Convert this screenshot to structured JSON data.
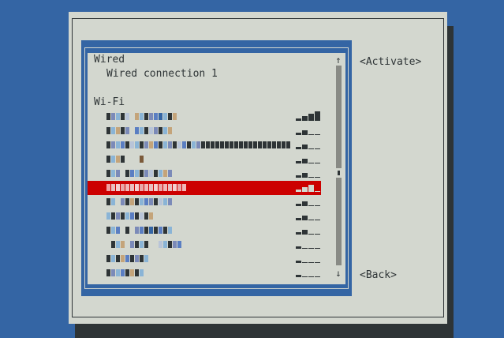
{
  "list": {
    "sections": [
      {
        "label": "Wired",
        "connections": [
          "Wired connection 1"
        ]
      },
      {
        "label": "Wi-Fi"
      }
    ],
    "scroll_up": "↑",
    "scroll_down": "↓"
  },
  "wifi_networks": [
    {
      "signal": 4,
      "selected": false,
      "ssid_blocks": [
        "#2e3436",
        "#7b8ab8",
        "#8ab4d6",
        "#2e3436",
        "#b8c4d8",
        "#d3d7cf",
        "#c4a47a",
        "#8ab4d6",
        "#2e3436",
        "#7b8ab8",
        "#5a7ec2",
        "#3465a4",
        "#8ab4d6",
        "#2e3436",
        "#c4a47a"
      ]
    },
    {
      "signal": 2,
      "selected": false,
      "ssid_blocks": [
        "#2e3436",
        "#8ab4d6",
        "#c4a47a",
        "#2e3436",
        "#7b8ab8",
        "#d3d7cf",
        "#5a7ec2",
        "#8ab4d6",
        "#2e3436",
        "#b8c4d8",
        "#7b8ab8",
        "#2e3436",
        "#8ab4d6",
        "#c4a47a"
      ]
    },
    {
      "signal": 2,
      "selected": false,
      "ssid_blocks": [
        "#2e3436",
        "#7b8ab8",
        "#8ab4d6",
        "#5a7ec2",
        "#2e3436",
        "#b8c4d8",
        "#8ab4d6",
        "#2e3436",
        "#7b8ab8",
        "#c4a47a",
        "#5a7ec2",
        "#2e3436",
        "#8ab4d6",
        "#7b8ab8",
        "#2e3436",
        "#b8c4d8",
        "#5a7ec2",
        "#2e3436",
        "#8ab4d6",
        "#7b8ab8",
        "#2e3436",
        "#2e3436",
        "#2e3436",
        "#2e3436",
        "#2e3436",
        "#2e3436",
        "#2e3436",
        "#2e3436",
        "#2e3436",
        "#2e3436",
        "#2e3436",
        "#2e3436",
        "#2e3436",
        "#2e3436",
        "#2e3436",
        "#2e3436",
        "#2e3436",
        "#2e3436",
        "#2e3436"
      ]
    },
    {
      "signal": 2,
      "selected": false,
      "ssid_blocks": [
        "#2e3436",
        "#8ab4d6",
        "#c4a47a",
        "#2e3436",
        "#d3d7cf",
        "#d3d7cf",
        "#d3d7cf",
        "#7b5a3a"
      ]
    },
    {
      "signal": 2,
      "selected": false,
      "ssid_blocks": [
        "#2e3436",
        "#8ab4d6",
        "#7b8ab8",
        "#d3d7cf",
        "#2e3436",
        "#5a7ec2",
        "#8ab4d6",
        "#2e3436",
        "#7b8ab8",
        "#b8c4d8",
        "#2e3436",
        "#8ab4d6",
        "#c4a47a",
        "#7b8ab8"
      ]
    },
    {
      "signal": 3,
      "selected": true,
      "ssid_blocks": [
        "#f0a0a0",
        "#e8c0c0",
        "#f4d0d0",
        "#e8a8a8",
        "#f0b8b8",
        "#e8c0c0",
        "#f4d0d0",
        "#e8a8a8",
        "#f0b8b8",
        "#e8c0c0",
        "#f4d0d0",
        "#e8a8a8",
        "#f0b8b8",
        "#e8c0c0",
        "#f4d0d0",
        "#e8a8a8",
        "#f0b8b8"
      ]
    },
    {
      "signal": 2,
      "selected": false,
      "ssid_blocks": [
        "#2e3436",
        "#8ab4d6",
        "#d3d7cf",
        "#7b8ab8",
        "#2e3436",
        "#c4a47a",
        "#2e3436",
        "#8ab4d6",
        "#5a7ec2",
        "#7b8ab8",
        "#2e3436",
        "#b8c4d8",
        "#8ab4d6",
        "#7b8ab8"
      ]
    },
    {
      "signal": 2,
      "selected": false,
      "ssid_blocks": [
        "#8ab4d6",
        "#2e3436",
        "#7b8ab8",
        "#2e3436",
        "#8ab4d6",
        "#5a7ec2",
        "#2e3436",
        "#b8c4d8",
        "#2e3436",
        "#c4a47a"
      ]
    },
    {
      "signal": 2,
      "selected": false,
      "ssid_blocks": [
        "#2e3436",
        "#8ab4d6",
        "#5a7ec2",
        "#d3d7cf",
        "#2e3436",
        "#d3d7cf",
        "#7b8ab8",
        "#5a7ec2",
        "#2e3436",
        "#3465a4",
        "#2e3436",
        "#5a7ec2",
        "#2e3436",
        "#8ab4d6"
      ]
    },
    {
      "signal": 1,
      "selected": false,
      "ssid_blocks": [
        "#d3d7cf",
        "#2e3436",
        "#8ab4d6",
        "#c4a47a",
        "#d3d7cf",
        "#7b8ab8",
        "#2e3436",
        "#8ab4d6",
        "#2e3436",
        "#d3d7cf",
        "#d3d7cf",
        "#b8c4d8",
        "#8ab4d6",
        "#2e3436",
        "#7b8ab8",
        "#5a7ec2"
      ]
    },
    {
      "signal": 1,
      "selected": false,
      "ssid_blocks": [
        "#2e3436",
        "#8ab4d6",
        "#2e3436",
        "#c4a47a",
        "#5a7ec2",
        "#2e3436",
        "#7b8ab8",
        "#2e3436",
        "#8ab4d6"
      ]
    },
    {
      "signal": 1,
      "selected": false,
      "ssid_blocks": [
        "#2e3436",
        "#7b8ab8",
        "#8ab4d6",
        "#5a7ec2",
        "#2e3436",
        "#c4a47a",
        "#2e3436",
        "#8ab4d6"
      ]
    }
  ],
  "buttons": {
    "activate": "<Activate>",
    "back": "<Back>"
  },
  "colors": {
    "background": "#3465a4",
    "dialog": "#d3d7cf",
    "selection": "#cc0000",
    "text": "#2e3436",
    "scrollbar": "#888a85"
  }
}
